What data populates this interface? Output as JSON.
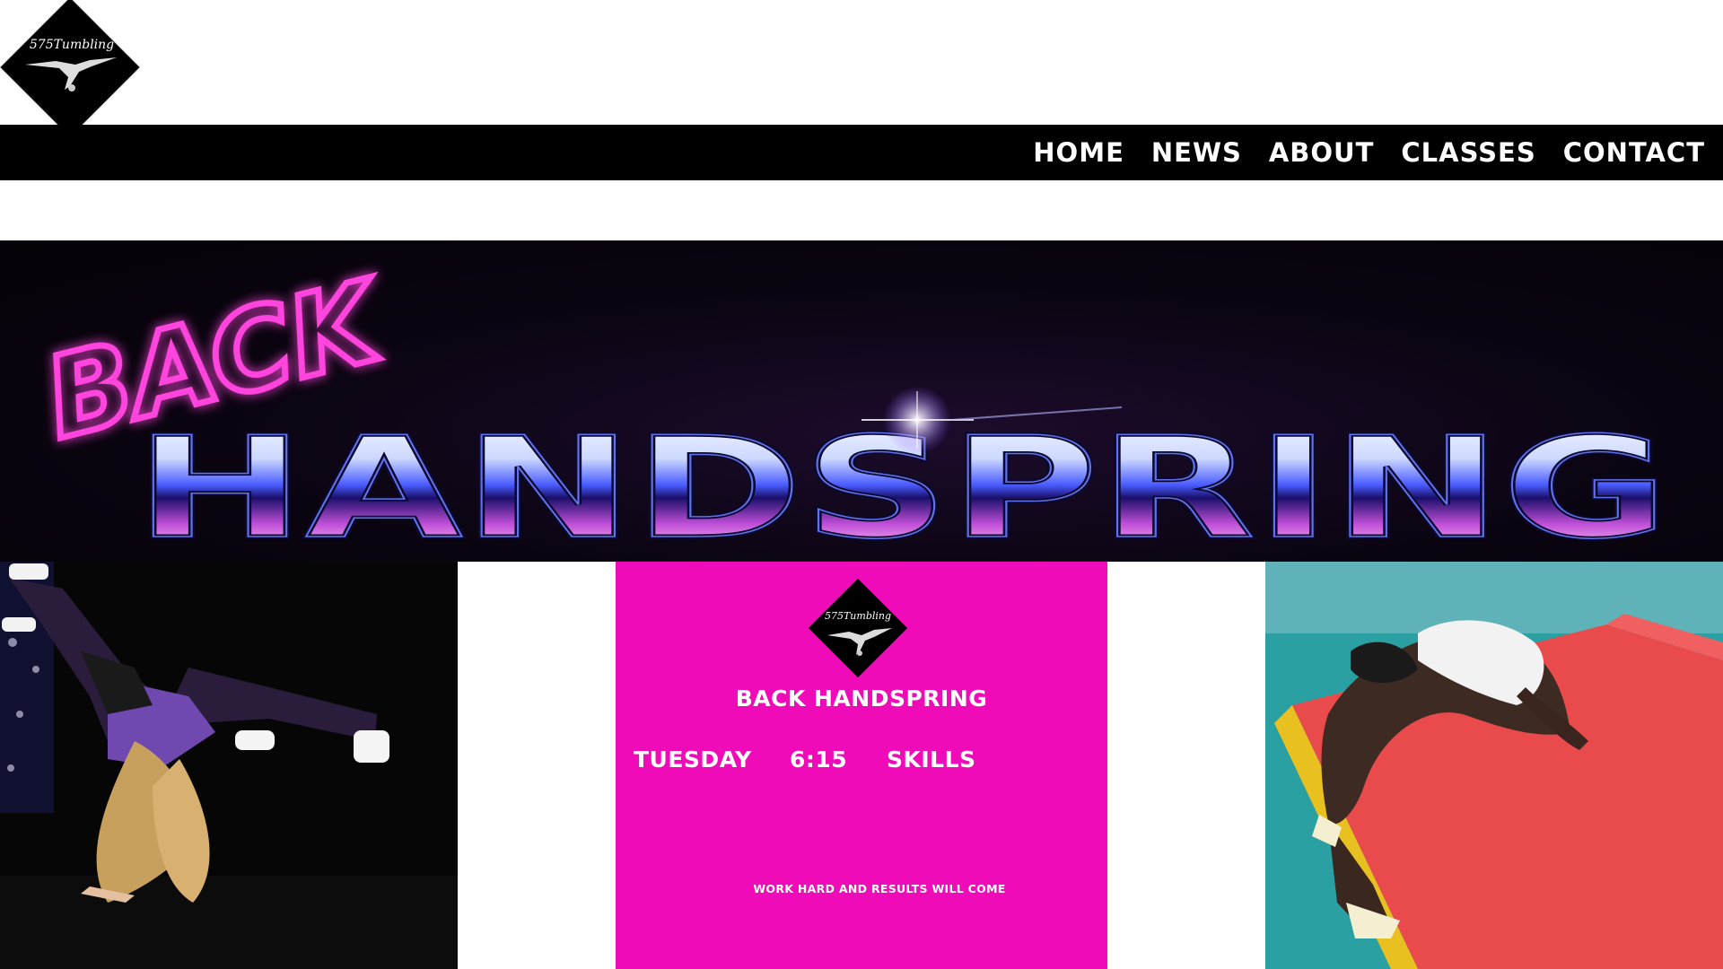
{
  "header": {
    "logo_text": "575Tumbling"
  },
  "nav": {
    "items": [
      {
        "label": "HOME"
      },
      {
        "label": "NEWS"
      },
      {
        "label": "ABOUT"
      },
      {
        "label": "CLASSES"
      },
      {
        "label": "CONTACT"
      }
    ]
  },
  "banner": {
    "script_word": "BACK",
    "chrome_word": "HANDSPRING"
  },
  "promo": {
    "logo_text": "575Tumbling",
    "title": "BACK HANDSPRING",
    "day": "TUESDAY",
    "time": "6:15",
    "level": "SKILLS",
    "tagline": "WORK HARD AND RESULTS WILL COME"
  },
  "colors": {
    "nav_bg": "#000000",
    "promo_bg": "#f00bb9",
    "neon_pink": "#ff3cd8"
  }
}
